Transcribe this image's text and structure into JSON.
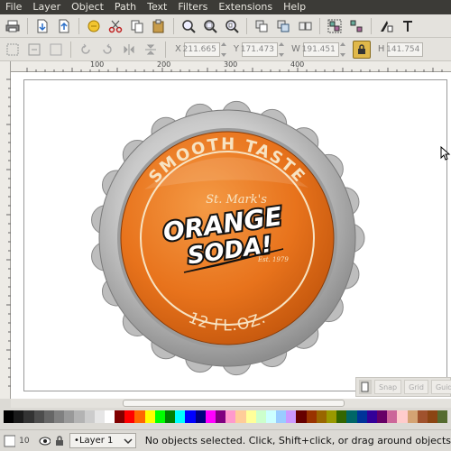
{
  "menubar": {
    "items": [
      {
        "label": "File"
      },
      {
        "label": "Layer"
      },
      {
        "label": "Object"
      },
      {
        "label": "Path"
      },
      {
        "label": "Text"
      },
      {
        "label": "Filters"
      },
      {
        "label": "Extensions"
      },
      {
        "label": "Help"
      }
    ]
  },
  "toolbar": {
    "icons": [
      "print-icon",
      "import-icon",
      "export-icon",
      "undo-icon",
      "cut-icon",
      "copy-icon",
      "paste-icon",
      "zoom-selection-icon",
      "zoom-drawing-icon",
      "zoom-page-icon",
      "duplicate-icon",
      "clone-icon",
      "unlink-clone-icon",
      "group-icon",
      "ungroup-icon",
      "fill-stroke-icon",
      "text-font-icon"
    ]
  },
  "controls": {
    "x_label": "X",
    "x_value": "211.665",
    "y_label": "Y",
    "y_value": "171.473",
    "w_label": "W",
    "w_value": "191.451",
    "h_label": "H",
    "h_value": "141.754",
    "lock_icon": "lock-icon"
  },
  "ruler": {
    "marks": [
      "100",
      "200",
      "300",
      "400"
    ]
  },
  "artwork": {
    "top_text": "SMOOTH TASTE",
    "brand_script": "St. Mark's",
    "line1": "ORANGE",
    "line2": "SODA!",
    "est": "Est. 1979",
    "bottom_text": "12 FL.OZ.",
    "colors": {
      "orange": "#e8731c",
      "orange_dark": "#c4570d",
      "cream": "#f7e3c2",
      "silver": "#c8c8c8"
    }
  },
  "snapbar": {
    "buttons": [
      "Snap",
      "Grid",
      "Guide"
    ]
  },
  "palette": {
    "colors": [
      "#000000",
      "#1a1a1a",
      "#333333",
      "#4d4d4d",
      "#666666",
      "#808080",
      "#999999",
      "#b3b3b3",
      "#cccccc",
      "#e6e6e6",
      "#ffffff",
      "#800000",
      "#ff0000",
      "#ff6600",
      "#ffff00",
      "#00ff00",
      "#008000",
      "#00ffff",
      "#0000ff",
      "#000080",
      "#ff00ff",
      "#800080",
      "#ff99cc",
      "#ffcc99",
      "#ffff99",
      "#ccffcc",
      "#ccffff",
      "#99ccff",
      "#cc99ff",
      "#660000",
      "#993300",
      "#996600",
      "#999900",
      "#336600",
      "#006666",
      "#003399",
      "#330099",
      "#660066",
      "#cc6699",
      "#ffcccc",
      "#d4a373",
      "#a0522d",
      "#8b4513",
      "#556b2f"
    ]
  },
  "status": {
    "opacity_label": "10",
    "layer_value": "•Layer 1",
    "message": "No objects selected. Click, Shift+click, or drag around objects"
  }
}
